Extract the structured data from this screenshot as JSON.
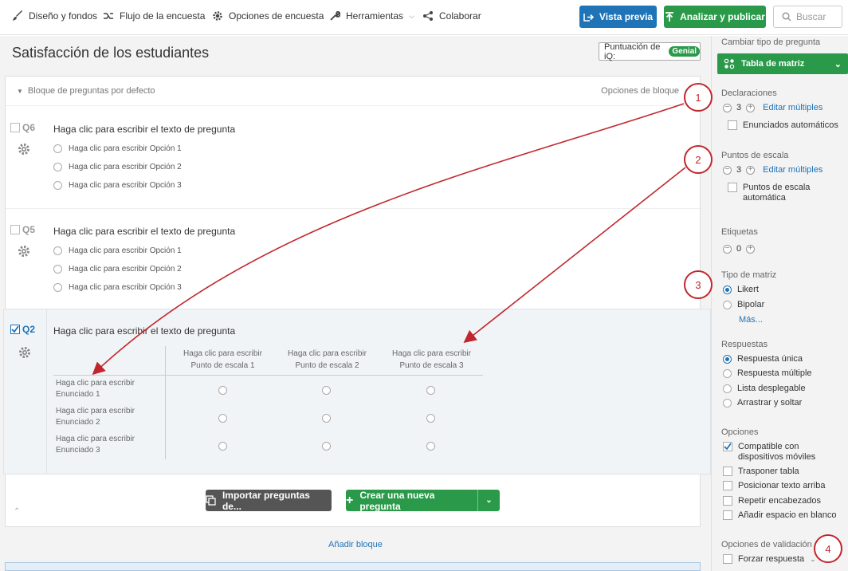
{
  "toolbar": {
    "nav": [
      {
        "label": "Diseño y fondos",
        "icon": "paintbrush-icon"
      },
      {
        "label": "Flujo de la encuesta",
        "icon": "flow-icon"
      },
      {
        "label": "Opciones de encuesta",
        "icon": "gear-icon"
      },
      {
        "label": "Herramientas",
        "icon": "wrench-icon"
      },
      {
        "label": "Colaborar",
        "icon": "share-icon"
      }
    ],
    "preview_label": "Vista previa",
    "publish_label": "Analizar y publicar",
    "search_placeholder": "Buscar"
  },
  "survey": {
    "title": "Satisfacción de los estudiantes",
    "iq_label": "Puntuación de iQ:",
    "iq_value": "Genial"
  },
  "block": {
    "title": "Bloque de preguntas por defecto",
    "options_label": "Opciones de bloque"
  },
  "questions": [
    {
      "id": "Q6",
      "text": "Haga clic para escribir el texto de pregunta",
      "options": [
        "Haga clic para escribir Opción 1",
        "Haga clic para escribir Opción 2",
        "Haga clic para escribir Opción 3"
      ]
    },
    {
      "id": "Q5",
      "text": "Haga clic para escribir el texto de pregunta",
      "options": [
        "Haga clic para escribir Opción 1",
        "Haga clic para escribir Opción 2",
        "Haga clic para escribir Opción 3"
      ]
    }
  ],
  "q2": {
    "id": "Q2",
    "text": "Haga clic para escribir el texto de pregunta",
    "columns": [
      [
        "Haga clic para escribir",
        "Punto de escala 1"
      ],
      [
        "Haga clic para escribir",
        "Punto de escala 2"
      ],
      [
        "Haga clic para escribir",
        "Punto de escala 3"
      ]
    ],
    "rows": [
      [
        "Haga clic para escribir",
        "Enunciado 1"
      ],
      [
        "Haga clic para escribir",
        "Enunciado 2"
      ],
      [
        "Haga clic para escribir",
        "Enunciado 3"
      ]
    ]
  },
  "actions": {
    "import_label": "Importar preguntas de...",
    "new_question_label": "Crear una nueva pregunta",
    "add_block_label": "Añadir bloque"
  },
  "panel": {
    "change_type_label": "Cambiar tipo de pregunta",
    "question_type": "Tabla de matriz",
    "statements": {
      "label": "Declaraciones",
      "value": "3",
      "edit": "Editar múltiples",
      "auto": "Enunciados automáticos"
    },
    "scale": {
      "label": "Puntos de escala",
      "value": "3",
      "edit": "Editar múltiples",
      "auto": "Puntos de escala automática"
    },
    "labels": {
      "label": "Etiquetas",
      "value": "0"
    },
    "matrix_type": {
      "label": "Tipo de matriz",
      "options": [
        "Likert",
        "Bipolar"
      ],
      "selected": "Likert",
      "more": "Más..."
    },
    "answers": {
      "label": "Respuestas",
      "options": [
        "Respuesta única",
        "Respuesta múltiple",
        "Lista desplegable",
        "Arrastrar y soltar"
      ],
      "selected": "Respuesta única"
    },
    "options": {
      "label": "Opciones",
      "items": [
        {
          "label": "Compatible con dispositivos móviles",
          "checked": true
        },
        {
          "label": "Trasponer tabla",
          "checked": false
        },
        {
          "label": "Posicionar texto arriba",
          "checked": false
        },
        {
          "label": "Repetir encabezados",
          "checked": false
        },
        {
          "label": "Añadir espacio en blanco",
          "checked": false
        }
      ]
    },
    "validation": {
      "label": "Opciones de validación",
      "force": "Forzar respuesta"
    }
  },
  "callouts": [
    "1",
    "2",
    "3",
    "4"
  ],
  "colors": {
    "accent_blue": "#1f73b7",
    "green": "#2a9a4a",
    "callout_red": "#c0272d"
  }
}
